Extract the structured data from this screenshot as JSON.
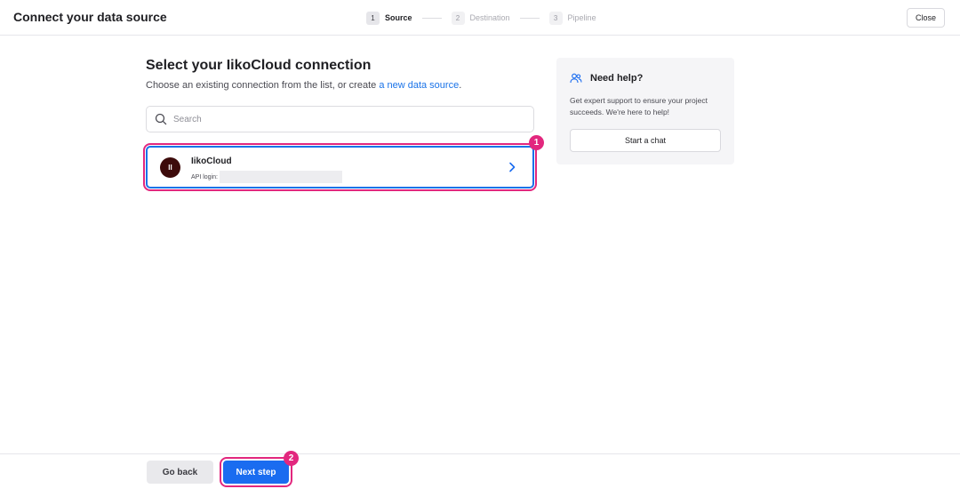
{
  "header": {
    "title": "Connect your data source",
    "close_label": "Close",
    "steps": [
      {
        "num": "1",
        "label": "Source"
      },
      {
        "num": "2",
        "label": "Destination"
      },
      {
        "num": "3",
        "label": "Pipeline"
      }
    ]
  },
  "main": {
    "title": "Select your IikoCloud connection",
    "subtitle_prefix": "Choose an existing connection from the list, or create ",
    "subtitle_link": "a new data source",
    "subtitle_suffix": ".",
    "search_placeholder": "Search",
    "connections": [
      {
        "avatar_text": "II",
        "name": "IikoCloud",
        "login_label": "API login:"
      }
    ]
  },
  "help": {
    "title": "Need help?",
    "text": "Get expert support to ensure your project succeeds. We're here to help!",
    "chat_label": "Start a chat"
  },
  "footer": {
    "back_label": "Go back",
    "next_label": "Next step"
  },
  "annotations": {
    "badge_1": "1",
    "badge_2": "2"
  },
  "colors": {
    "accent": "#1a6cf0",
    "link": "#1a73e8",
    "highlight": "#e2277e",
    "avatar_bg": "#3d0b0b"
  }
}
